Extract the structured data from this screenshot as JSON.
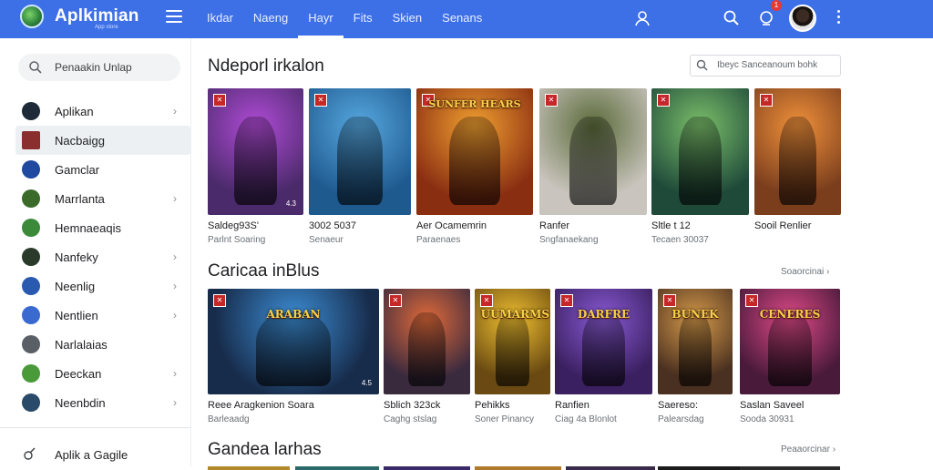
{
  "header": {
    "app_title": "Aplkimian",
    "app_subtitle": "App store",
    "nav": [
      "Ikdar",
      "Naeng",
      "Hayr",
      "Fits",
      "Skien",
      "Senans"
    ],
    "active_nav_index": 2,
    "notification_count": "1",
    "brand_color": "#3d6fe6"
  },
  "sidebar": {
    "search_placeholder": "Penaakin Unlap",
    "items": [
      {
        "label": "Aplikan",
        "icon": "home-icon",
        "chevron": true
      },
      {
        "label": "Nacbaigg",
        "icon": "game-tile-icon",
        "chevron": false,
        "active": true
      },
      {
        "label": "Gamclar",
        "icon": "controller-icon",
        "chevron": false
      },
      {
        "label": "Marrlanta",
        "icon": "character-icon",
        "chevron": true
      },
      {
        "label": "Hemnaeaqis",
        "icon": "face-icon",
        "chevron": false
      },
      {
        "label": "Nanfeky",
        "icon": "figure-icon",
        "chevron": true
      },
      {
        "label": "Neenlig",
        "icon": "shield-icon",
        "chevron": true
      },
      {
        "label": "Nentlien",
        "icon": "person-circle-icon",
        "chevron": true
      },
      {
        "label": "Narlalaias",
        "icon": "frame-icon",
        "chevron": false
      },
      {
        "label": "Deeckan",
        "icon": "puzzle-icon",
        "chevron": true
      },
      {
        "label": "Neenbdin",
        "icon": "landscape-icon",
        "chevron": true
      }
    ],
    "footer_label": "Aplik a Gagile"
  },
  "sections": [
    {
      "title": "Ndeporl irkalon",
      "filter_placeholder": "Ibeyc Sanceanoum bohk",
      "cards": [
        {
          "name": "Saldeg93S'",
          "meta": "Parlnt Soaring",
          "rating": "4.3",
          "theme": "#4a2a6a",
          "accent": "#b04bd6",
          "banner": ""
        },
        {
          "name": "3002 5037",
          "meta": "Senaeur",
          "rating": "",
          "theme": "#1f5a8f",
          "accent": "#56a8e0",
          "banner": ""
        },
        {
          "name": "Aer Ocamemrin",
          "meta": "Paraenaes",
          "rating": "",
          "theme": "#8a2e12",
          "accent": "#f0a030",
          "banner": "SUNFER HEARS"
        },
        {
          "name": "Ranfer",
          "meta": "Sngfanaekang",
          "rating": "",
          "theme": "#c9c4bd",
          "accent": "#5a6b3a",
          "banner": ""
        },
        {
          "name": "Sltle t 12",
          "meta": "Tecaen 30037",
          "rating": "",
          "theme": "#1f4a3a",
          "accent": "#7bbf6a",
          "banner": ""
        },
        {
          "name": "Sooil Renlier",
          "meta": "",
          "rating": "",
          "theme": "#7a3e1d",
          "accent": "#f0903a",
          "banner": ""
        }
      ]
    },
    {
      "title": "Caricaa inBlus",
      "see_more": "Soaorcinai ›",
      "cards": [
        {
          "name": "Reee Aragkenion Soara",
          "meta": "Barleaadg",
          "rating": "4.5",
          "theme": "#172b4a",
          "accent": "#3c8ed6",
          "banner": "ARABAN"
        },
        {
          "name": "Sblich 323ck",
          "meta": "Caghg stslag",
          "rating": "",
          "theme": "#3a2a3e",
          "accent": "#e06a3a",
          "banner": ""
        },
        {
          "name": "Pehikks",
          "meta": "Soner Pinancy",
          "rating": "",
          "theme": "#6a4a12",
          "accent": "#f0c030",
          "banner": "UUMARMS"
        },
        {
          "name": "Ranfien",
          "meta": "Ciag 4a Blonlot",
          "rating": "",
          "theme": "#3a2060",
          "accent": "#8a5ad6",
          "banner": "DARFRE"
        },
        {
          "name": "Saereso:",
          "meta": "Palearsdag",
          "rating": "",
          "theme": "#4a3020",
          "accent": "#d69a4a",
          "banner": "BUNEK"
        },
        {
          "name": "Saslan Saveel",
          "meta": "Sooda 30931",
          "rating": "",
          "theme": "#4a1a3a",
          "accent": "#e04a8a",
          "banner": "CENERES"
        }
      ]
    },
    {
      "title": "Gandea larhas",
      "see_more": "Peaaorcinar ›"
    }
  ]
}
